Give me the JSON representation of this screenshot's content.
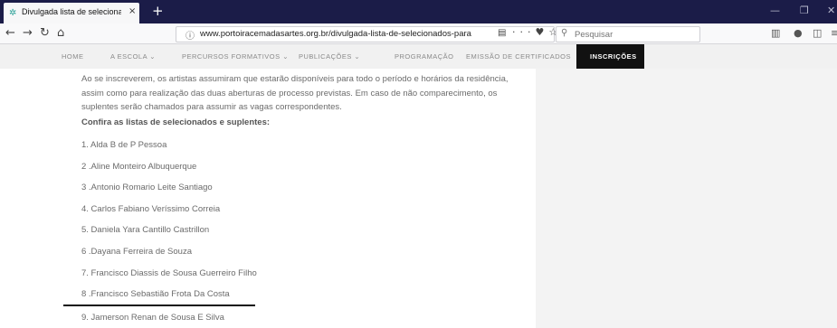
{
  "browser": {
    "tab_title": "Divulgada lista de selecionado:",
    "tab_close": "×",
    "new_tab": "+",
    "url": "www.portoiracemadasartes.org.br/divulgada-lista-de-selecionados-para-residen",
    "search_placeholder": "Pesquisar",
    "overflow_menu": "···"
  },
  "site_nav": {
    "items": [
      {
        "label": "HOME"
      },
      {
        "label": "A ESCOLA  ⌄"
      },
      {
        "label": "PERCURSOS FORMATIVOS  ⌄"
      },
      {
        "label": "PUBLICAÇÕES  ⌄"
      },
      {
        "label": "PROGRAMAÇÃO"
      },
      {
        "label": "EMISSÃO DE CERTIFICADOS"
      }
    ],
    "active": "INSCRIÇÕES"
  },
  "content": {
    "paragraph": "Ao se inscreverem, os artistas assumiram que estarão disponíveis para todo o período e horários da residência, assim como para realização das duas aberturas de processo previstas. Em caso de não comparecimento, os suplentes serão chamados para assumir as vagas correspondentes.",
    "heading": "Confira as listas de selecionados e suplentes:",
    "list": [
      "1. Alda B de P Pessoa",
      "2 .Aline Monteiro Albuquerque",
      "3 .Antonio Romario Leite Santiago",
      "4. Carlos Fabiano Veríssimo Correia",
      "5. Daniela Yara Cantillo Castrillon",
      "6 .Dayana Ferreira de Souza",
      "7. Francisco Diassis de Sousa Guerreiro Filho",
      "8 .Francisco Sebastião Frota Da Costa",
      "9. Jamerson Renan de Sousa E Silva"
    ]
  }
}
